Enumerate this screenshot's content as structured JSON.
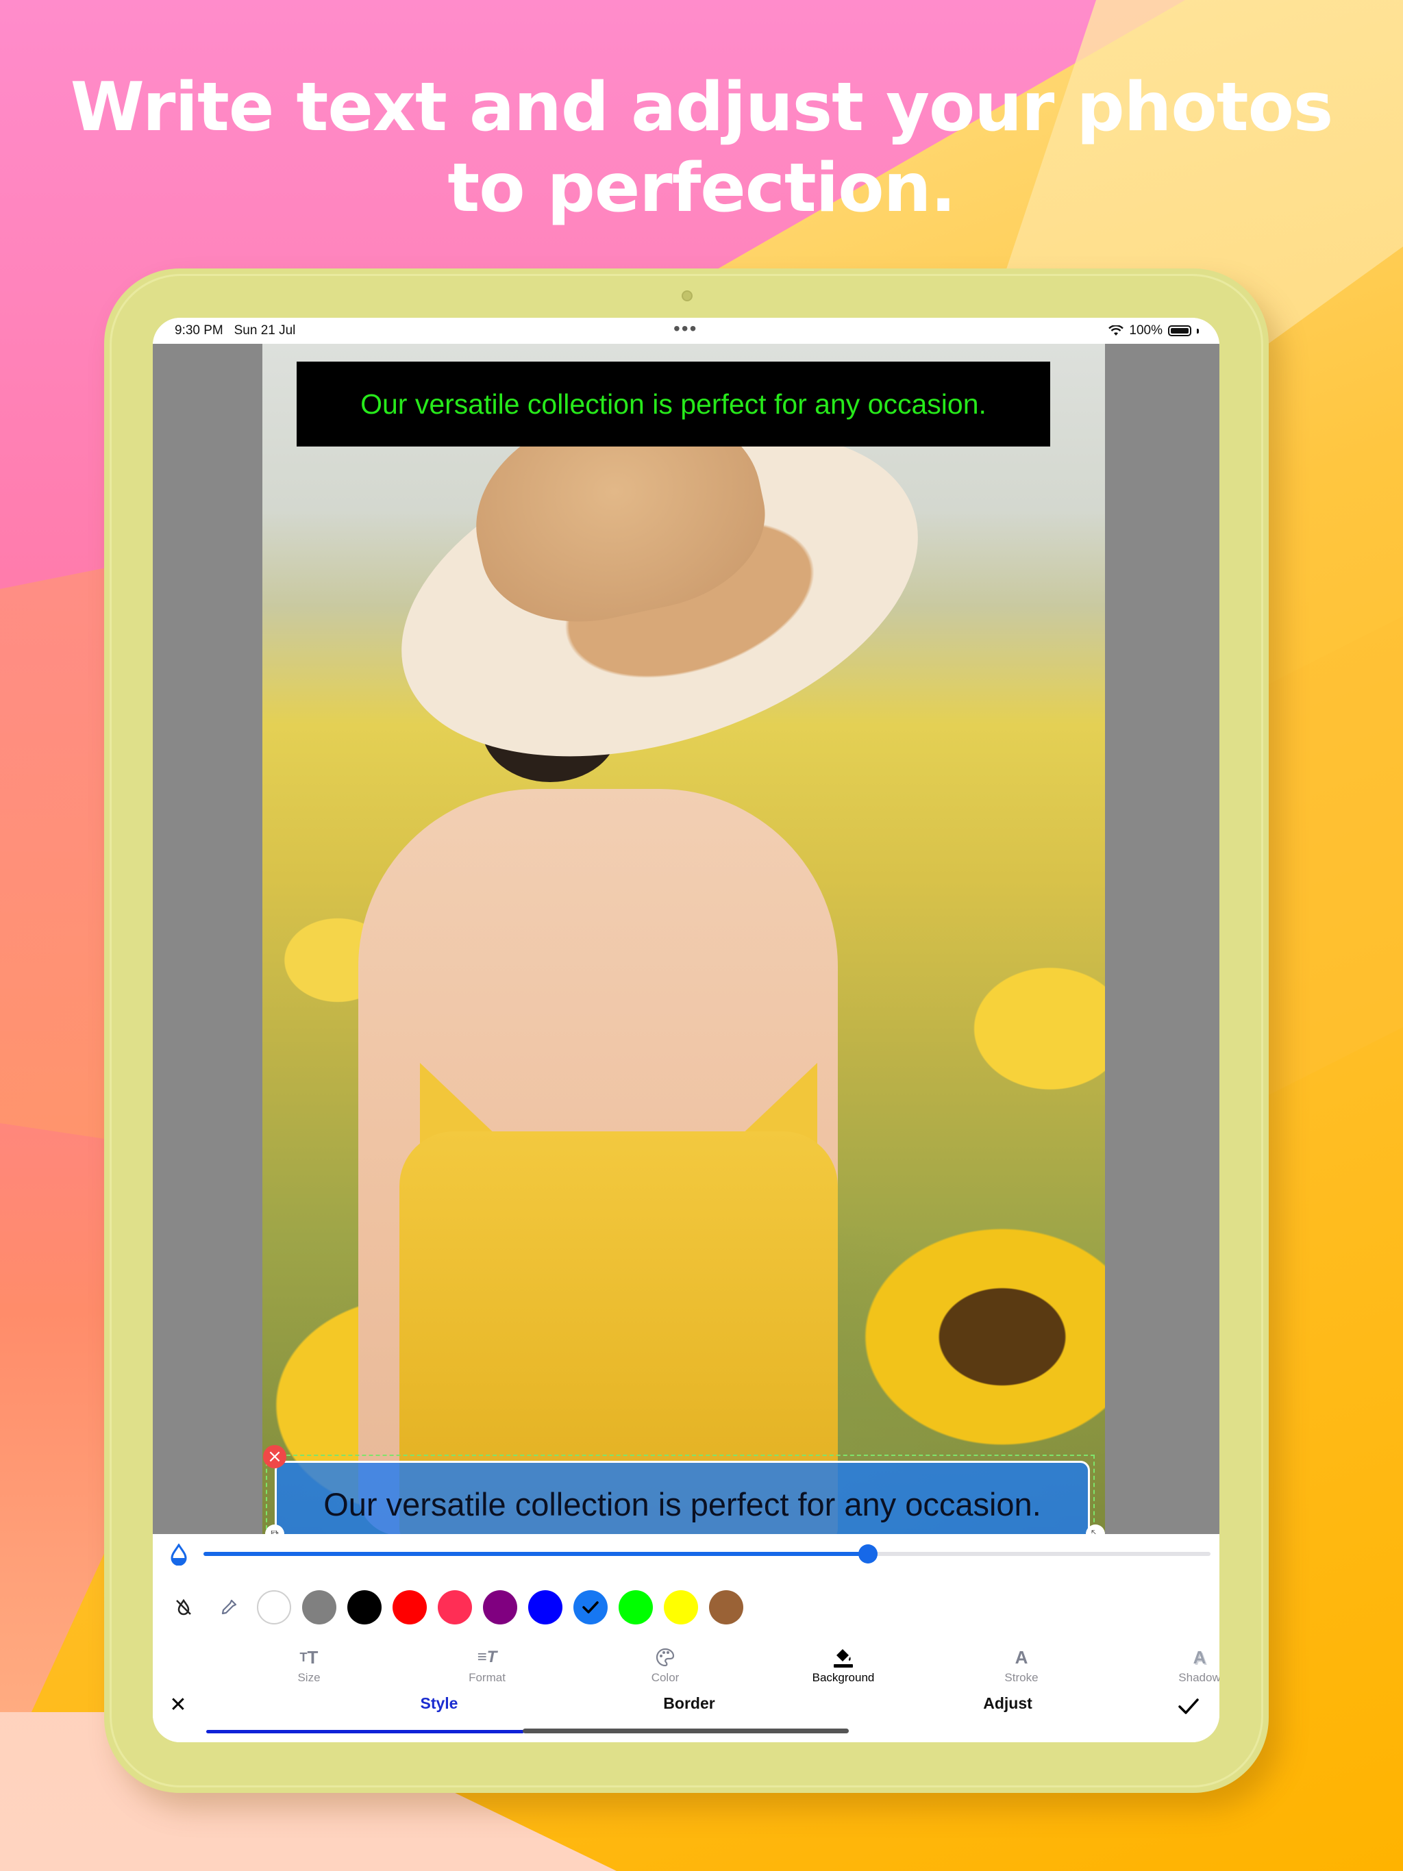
{
  "headline": {
    "line1": "Write text and adjust your photos",
    "line2": "to perfection."
  },
  "status_bar": {
    "time": "9:30 PM",
    "date": "Sun 21 Jul",
    "more": "•••",
    "battery": "100%"
  },
  "canvas": {
    "top_text": "Our versatile collection is perfect for any occasion.",
    "top_text_color": "#27ea1b",
    "top_text_background": "#000000",
    "bottom_text": "Our versatile collection is perfect for any occasion.",
    "bottom_text_background": "#1978f5"
  },
  "toolbar": {
    "opacity_value": 0.66,
    "accent_color": "#1668e8",
    "swatches": [
      {
        "name": "white",
        "color": "#ffffff"
      },
      {
        "name": "gray",
        "color": "#808080"
      },
      {
        "name": "black",
        "color": "#000000"
      },
      {
        "name": "red",
        "color": "#ff0000"
      },
      {
        "name": "pink-red",
        "color": "#ff2e55"
      },
      {
        "name": "purple",
        "color": "#800080"
      },
      {
        "name": "blue",
        "color": "#0000ff"
      },
      {
        "name": "sky-blue",
        "color": "#1677f2",
        "selected": true
      },
      {
        "name": "green",
        "color": "#00ff00"
      },
      {
        "name": "yellow",
        "color": "#ffff00"
      },
      {
        "name": "brown",
        "color": "#9a6236"
      }
    ],
    "subtabs": [
      {
        "label": "Size",
        "icon": "text-size-icon"
      },
      {
        "label": "Format",
        "icon": "text-format-icon"
      },
      {
        "label": "Color",
        "icon": "palette-icon"
      },
      {
        "label": "Background",
        "icon": "paint-bucket-icon",
        "active": true
      },
      {
        "label": "Stroke",
        "icon": "stroke-icon"
      },
      {
        "label": "Shadow",
        "icon": "shadow-icon"
      }
    ],
    "maintabs": [
      {
        "label": "Style",
        "active": true
      },
      {
        "label": "Border"
      },
      {
        "label": "Adjust"
      }
    ]
  }
}
